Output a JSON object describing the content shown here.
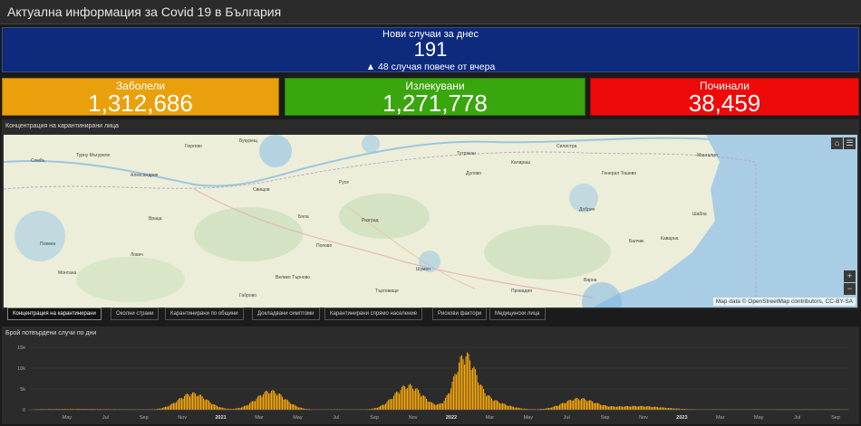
{
  "header": {
    "title": "Актуална информация за Covid 19 в България"
  },
  "new_cases": {
    "label": "Нови случаи за днес",
    "value": "191",
    "change": "▲ 48 случая повече от вчера"
  },
  "stats": {
    "infected": {
      "label": "Заболели",
      "value": "1,312,686",
      "color": "#e9a00c"
    },
    "recovered": {
      "label": "Излекувани",
      "value": "1,271,778",
      "color": "#3aa60e"
    },
    "deaths": {
      "label": "Починали",
      "value": "38,459",
      "color": "#ef0a0a"
    }
  },
  "map": {
    "title": "Концентрация на карантинирани лица",
    "attribution": "Map data © OpenStreetMap contributors, CC-BY-SA",
    "buttons": {
      "home": "⌂",
      "list": "☰",
      "zoom_in": "+",
      "zoom_out": "−"
    },
    "cities": [
      "Сомбъ",
      "Турну Мъгуреле",
      "Гюргево",
      "Букурещ",
      "Александрия",
      "Плевен",
      "Ловеч",
      "Велико Търново",
      "Русе",
      "Разград",
      "Шумен",
      "Варна",
      "Добрич",
      "Силистра",
      "Тутракан",
      "Монтана",
      "Враца",
      "Габрово",
      "Търговище",
      "Провадия",
      "Балчик",
      "Каварна",
      "Шабла",
      "Мангалия",
      "Калараш",
      "Свищов",
      "Бяла",
      "Попово",
      "Дулово",
      "Генерал Тошево"
    ],
    "accent": "#f0f3e0"
  },
  "tabs": [
    "Концентрация на карантинирани",
    "Околни страни",
    "Карантинирани по общини",
    "Докладвани симптоми",
    "Карантинирани спрямо население",
    "Рискови фактори",
    "Медицински лица"
  ],
  "chart": {
    "title": "Брой потвърдени случи по дни",
    "bar_color": "#f5a60a"
  },
  "chart_data": {
    "type": "bar",
    "title": "Брой потвърдени случи по дни",
    "xlabel": "",
    "ylabel": "",
    "ylim": [
      0,
      15000
    ],
    "y_ticks": [
      "0",
      "5k",
      "10k",
      "15k"
    ],
    "x_ticks": [
      "May",
      "Jul",
      "Sep",
      "Nov",
      "2021",
      "Mar",
      "May",
      "Jul",
      "Sep",
      "Nov",
      "2022",
      "Mar",
      "May",
      "Jul",
      "Sep",
      "Nov",
      "2023",
      "Mar",
      "May",
      "Jul",
      "Sep"
    ],
    "grid": true,
    "peaks": [
      {
        "label": "Nov 2020",
        "approx_max": 4200
      },
      {
        "label": "Mar 2021",
        "approx_max": 4800
      },
      {
        "label": "Oct 2021",
        "approx_max": 6200
      },
      {
        "label": "Feb 2022",
        "approx_max": 12000
      },
      {
        "label": "Aug 2022",
        "approx_max": 2800
      }
    ]
  }
}
